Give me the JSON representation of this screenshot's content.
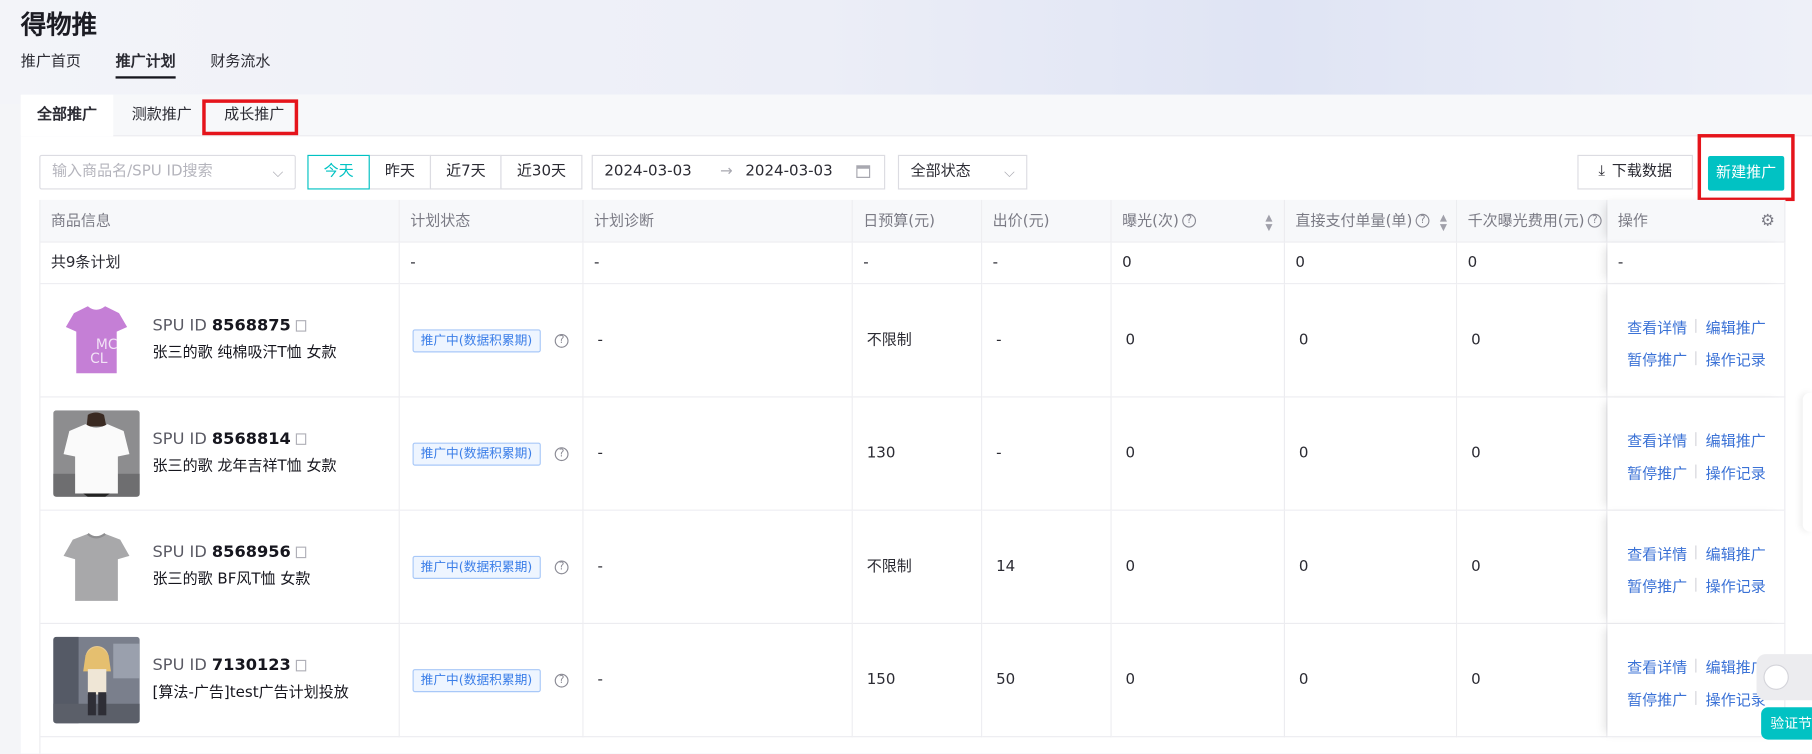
{
  "app": {
    "title": "得物推"
  },
  "top_nav": {
    "items": [
      "推广首页",
      "推广计划",
      "财务流水"
    ],
    "active": "推广计划"
  },
  "tabs": {
    "items": [
      "全部推广",
      "测款推广",
      "成长推广"
    ],
    "active": "全部推广"
  },
  "filters": {
    "search_placeholder": "输入商品名/SPU ID搜索",
    "date_buttons": [
      "今天",
      "昨天",
      "近7天",
      "近30天"
    ],
    "active_date": "今天",
    "start_date": "2024-03-03",
    "end_date": "2024-03-03",
    "range_arrow": "→",
    "status": "全部状态",
    "download_label": "下载数据",
    "new_label": "新建推广"
  },
  "table": {
    "columns": [
      "商品信息",
      "计划状态",
      "计划诊断",
      "日预算(元)",
      "出价(元)",
      "曝光(次)",
      "直接支付单量(单)",
      "千次曝光费用(元)",
      "操作"
    ],
    "summary": [
      "共9条计划",
      "-",
      "-",
      "-",
      "-",
      "0",
      "0",
      "0",
      "-"
    ],
    "spu_prefix": "SPU ID",
    "rows": [
      {
        "spu_id": "8568875",
        "name": "张三的歌 纯棉吸汗T恤 女款",
        "status": "推广中(数据积累期)",
        "diagnosis": "-",
        "budget": "不限制",
        "bid": "-",
        "exposure": "0",
        "orders": "0",
        "cpm": "0",
        "image": "purple-tshirt"
      },
      {
        "spu_id": "8568814",
        "name": "张三的歌 龙年吉祥T恤 女款",
        "status": "推广中(数据积累期)",
        "diagnosis": "-",
        "budget": "130",
        "bid": "-",
        "exposure": "0",
        "orders": "0",
        "cpm": "0",
        "image": "white-tshirt-model"
      },
      {
        "spu_id": "8568956",
        "name": "张三的歌 BF风T恤 女款",
        "status": "推广中(数据积累期)",
        "diagnosis": "-",
        "budget": "不限制",
        "bid": "14",
        "exposure": "0",
        "orders": "0",
        "cpm": "0",
        "image": "gray-tshirt"
      },
      {
        "spu_id": "7130123",
        "name": "[算法-广告]test广告计划投放",
        "status": "推广中(数据积累期)",
        "diagnosis": "-",
        "budget": "150",
        "bid": "50",
        "exposure": "0",
        "orders": "0",
        "cpm": "0",
        "image": "anime-figure"
      }
    ],
    "actions": [
      "查看详情",
      "编辑推广",
      "暂停推广",
      "操作记录"
    ]
  },
  "floating": {
    "verify_label": "验证节"
  },
  "colors": {
    "accent": "#01c2c3",
    "link": "#3b72d6",
    "highlight": "#e5141b",
    "status_tag": "#3b7ee8"
  }
}
